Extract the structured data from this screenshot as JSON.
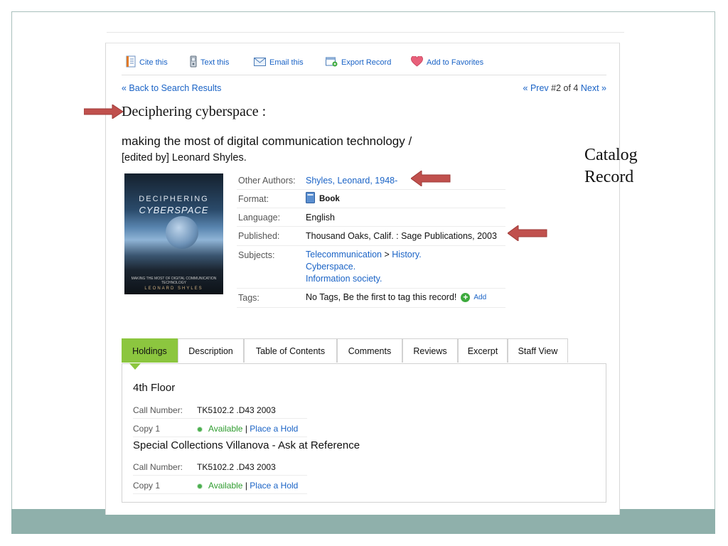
{
  "toolbar": {
    "items": [
      {
        "label": "Cite this",
        "icon": "cite-icon"
      },
      {
        "label": "Text this",
        "icon": "phone-icon"
      },
      {
        "label": "Email this",
        "icon": "email-icon"
      },
      {
        "label": "Export Record",
        "icon": "export-icon"
      },
      {
        "label": "Add to Favorites",
        "icon": "heart-icon"
      }
    ]
  },
  "nav": {
    "back": "« Back to Search Results",
    "prev": "« Prev",
    "position": "#2 of 4",
    "next": "Next »"
  },
  "record": {
    "title": "Deciphering cyberspace :",
    "subtitle": "making the most of digital communication technology /",
    "statement": "[edited by] Leonard Shyles."
  },
  "cover": {
    "line1": "DECIPHERING",
    "line2": "CYBERSPACE",
    "line3": "MAKING THE MOST OF DIGITAL COMMUNICATION TECHNOLOGY",
    "line4": "LEONARD SHYLES"
  },
  "details": {
    "other_authors_label": "Other Authors:",
    "other_authors": "Shyles, Leonard, 1948-",
    "format_label": "Format:",
    "format": "Book",
    "language_label": "Language:",
    "language": "English",
    "published_label": "Published:",
    "published": "Thousand Oaks, Calif. : Sage Publications, 2003",
    "subjects_label": "Subjects:",
    "subject1": "Telecommunication",
    "subject1_sep": ">",
    "subject1b": "History.",
    "subject2": "Cyberspace.",
    "subject3": "Information society.",
    "tags_label": "Tags:",
    "tags": "No Tags, Be the first to tag this record!",
    "add_label": "Add"
  },
  "tabs": [
    "Holdings",
    "Description",
    "Table of Contents",
    "Comments",
    "Reviews",
    "Excerpt",
    "Staff View"
  ],
  "holdings": [
    {
      "location": "4th Floor",
      "call_label": "Call Number:",
      "call_number": "TK5102.2 .D43 2003",
      "copy": "Copy 1",
      "status": "Available",
      "sep": "|",
      "hold": "Place a Hold"
    },
    {
      "location": "Special Collections Villanova - Ask at Reference",
      "call_label": "Call Number:",
      "call_number": "TK5102.2 .D43 2003",
      "copy": "Copy 1",
      "status": "Available",
      "sep": "|",
      "hold": "Place a Hold"
    }
  ],
  "annotation": {
    "line1": "Catalog",
    "line2": "Record",
    "arrow_color": "#c0504d"
  },
  "colors": {
    "link": "#1a63c6",
    "tab_active": "#8cc63f",
    "available": "#2e9c2e",
    "slide_band": "#8fb0ab"
  }
}
